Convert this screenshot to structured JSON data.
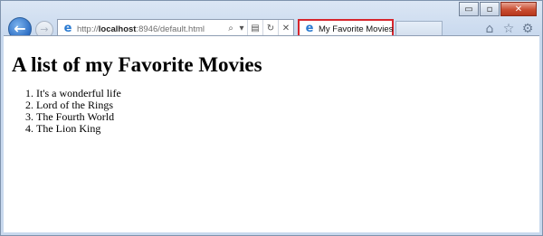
{
  "window": {
    "caption_buttons": {
      "minimize": "▭",
      "maximize": "▫",
      "close": "✕"
    }
  },
  "navigation": {
    "back_icon": "←",
    "forward_icon": "→",
    "address": {
      "host_prefix": "http://",
      "host": "localhost",
      "path": ":8946/default.html"
    },
    "search_icon": "⌕",
    "dropdown_icon": "▾",
    "compat_icon": "▤",
    "refresh_icon": "↻",
    "stop_icon": "✕"
  },
  "tab": {
    "title": "My Favorite Movies",
    "icon": "e"
  },
  "toolbar_icons": {
    "home": "⌂",
    "favorites": "☆",
    "tools": "⚙"
  },
  "page": {
    "heading": "A list of my Favorite Movies",
    "movies": [
      "It's a wonderful life",
      "Lord of the Rings",
      "The Fourth World",
      "The Lion King"
    ]
  }
}
